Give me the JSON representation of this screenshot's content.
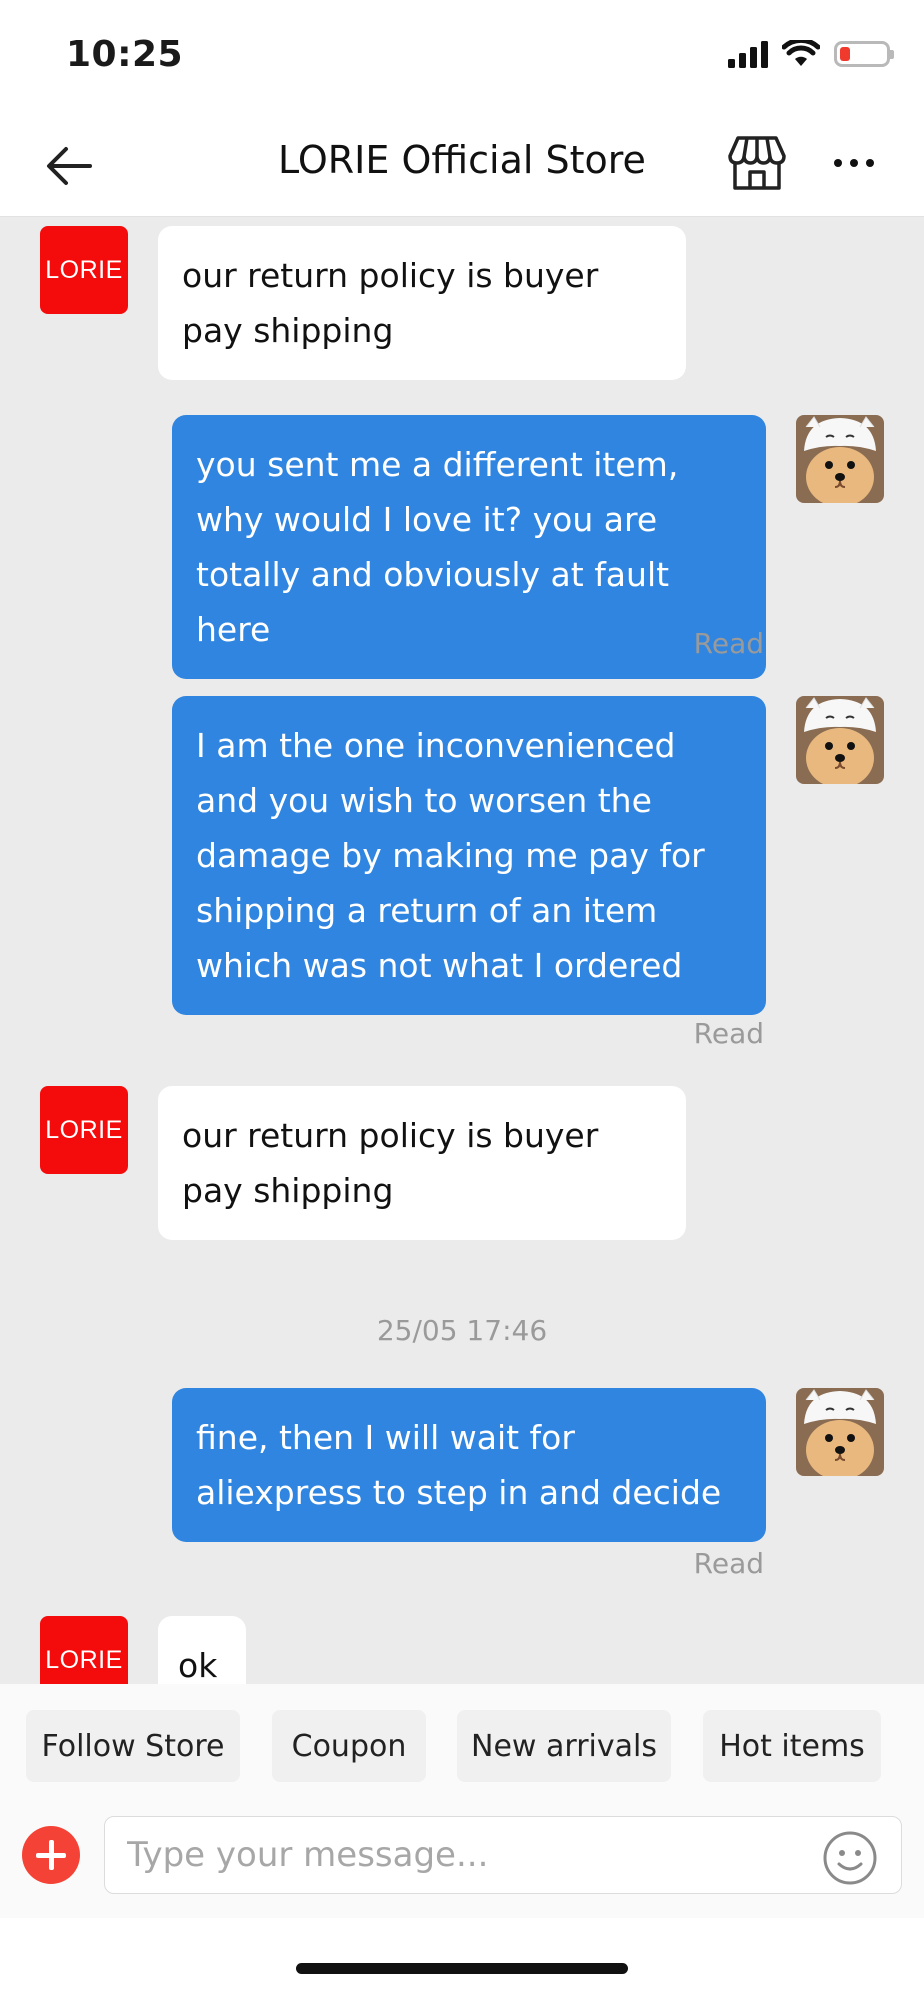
{
  "status_bar": {
    "time": "10:25"
  },
  "header": {
    "title": "LORIE Official Store",
    "back_icon": "arrow-left-icon",
    "store_icon": "storefront-icon",
    "more_icon": "more-dots-icon"
  },
  "store": {
    "avatar_label": "LORIE"
  },
  "messages": [
    {
      "from": "store",
      "text": "our return policy is buyer pay shipping"
    },
    {
      "from": "me",
      "text": "you sent me a different item, why would I love it? you are totally and obviously at fault here",
      "status": "Read"
    },
    {
      "from": "me",
      "text": "I am the one inconvenienced and you wish to worsen the damage by making me pay for shipping a return of an item which was not what I ordered",
      "status": "Read"
    },
    {
      "from": "store",
      "text": "our return policy is buyer pay shipping"
    },
    {
      "from": "me",
      "text": "fine, then I will wait for aliexpress to step in and decide",
      "status": "Read"
    },
    {
      "from": "store",
      "text": "ok"
    }
  ],
  "timestamp": "25/05 17:46",
  "quick_actions": [
    "Follow Store",
    "Coupon",
    "New arrivals",
    "Hot items"
  ],
  "composer": {
    "placeholder": "Type your message...",
    "value": ""
  },
  "colors": {
    "accent": "#2f85e0",
    "store_red": "#f40b0b",
    "plus_red": "#f44336",
    "chat_bg": "#ebebeb"
  }
}
